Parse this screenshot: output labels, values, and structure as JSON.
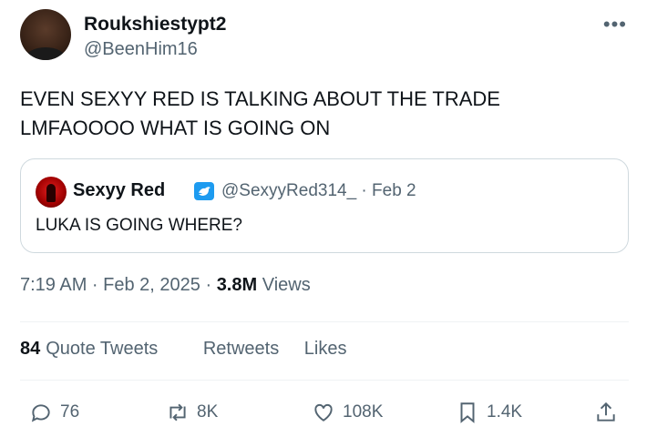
{
  "author": {
    "display_name": "Roukshiestypt2",
    "handle": "@BeenHim16"
  },
  "tweet_text_line1": "EVEN SEXYY RED IS TALKING ABOUT THE TRADE",
  "tweet_text_line2": "LMFAOOOO WHAT IS GOING ON",
  "quoted": {
    "display_name": "Sexyy Red",
    "handle_date": "@SexyyRed314_ · Feb 2",
    "text": "LUKA IS GOING WHERE?"
  },
  "meta": {
    "time_date": "7:19 AM · Feb 2, 2025 · ",
    "views_count": "3.8M",
    "views_label": " Views"
  },
  "stats": {
    "quote_count": "84",
    "quote_label": "Quote Tweets",
    "retweets_label": "Retweets",
    "likes_label": "Likes"
  },
  "actions": {
    "replies": "76",
    "retweets": "8K",
    "likes": "108K",
    "bookmarks": "1.4K"
  },
  "icons": [
    "more-icon",
    "verified-icon",
    "reply-icon",
    "retweet-icon",
    "like-icon",
    "bookmark-icon",
    "share-icon"
  ],
  "colors": {
    "text": "#0f1419",
    "secondary": "#536471",
    "verified": "#1d9bf0",
    "border": "#cfd9de"
  }
}
